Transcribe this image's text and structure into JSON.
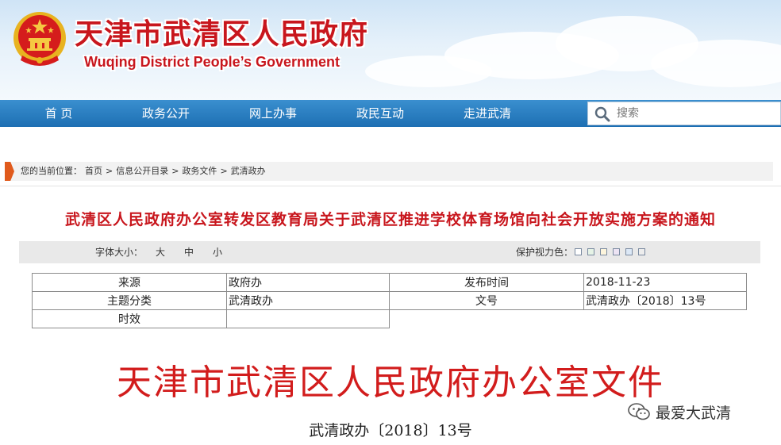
{
  "header": {
    "title_cn": "天津市武清区人民政府",
    "title_en": "Wuqing District People’s Government",
    "brand_color": "#c8161d"
  },
  "nav": {
    "items": [
      {
        "label": "首  页"
      },
      {
        "label": "政务公开"
      },
      {
        "label": "网上办事"
      },
      {
        "label": "政民互动"
      },
      {
        "label": "走进武清"
      }
    ],
    "search_placeholder": "搜索",
    "search_icon": "search-icon",
    "bar_color": "#2a7fc1"
  },
  "breadcrumb": {
    "prefix": "您的当前位置：",
    "items": [
      "首页",
      "信息公开目录",
      "政务文件",
      "武清政办"
    ],
    "separator": ">"
  },
  "article": {
    "title": "武清区人民政府办公室转发区教育局关于武清区推进学校体育场馆向社会开放实施方案的通知",
    "font_size_label": "字体大小：",
    "font_sizes": [
      "大",
      "中",
      "小"
    ],
    "eye_protect_label": "保护视力色：",
    "eye_colors": [
      "#ffffff",
      "#e6f3e6",
      "#fdf5dc",
      "#ede4f4",
      "#dce8f6",
      "#ededed"
    ]
  },
  "meta_table": {
    "rows": [
      {
        "k1": "来源",
        "v1": "政府办",
        "k2": "发布时间",
        "v2": "2018-11-23"
      },
      {
        "k1": "主题分类",
        "v1": "武清政办",
        "k2": "文号",
        "v2": "武清政办〔2018〕13号"
      },
      {
        "k1": "时效",
        "v1": ""
      }
    ]
  },
  "document": {
    "head": "天津市武清区人民政府办公室文件",
    "number": "武清政办〔2018〕13号"
  },
  "watermark": {
    "text": "最爱大武清",
    "icon": "wechat-icon"
  }
}
